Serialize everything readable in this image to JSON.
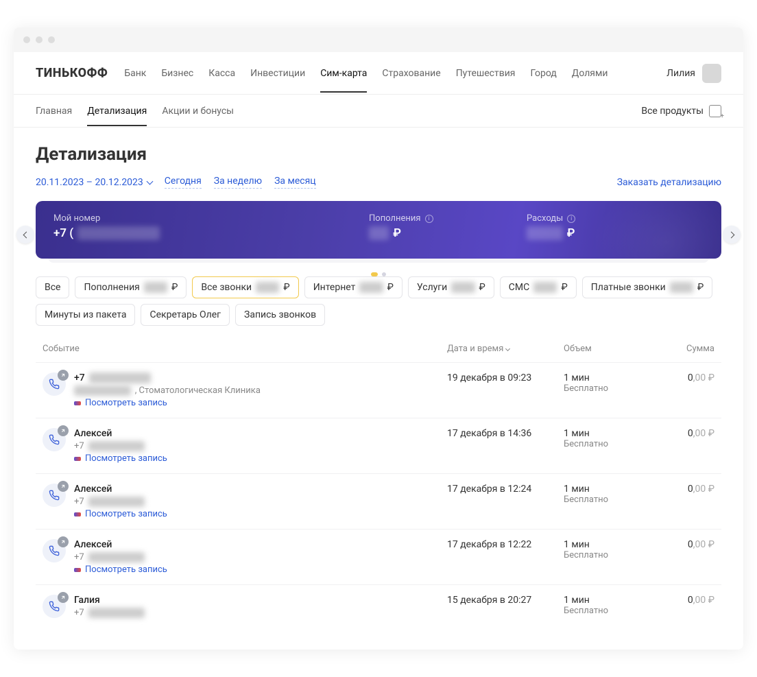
{
  "brand": "ТИНЬКОФФ",
  "user": {
    "name": "Лилия"
  },
  "topnav": [
    "Банк",
    "Бизнес",
    "Касса",
    "Инвестиции",
    "Сим-карта",
    "Страхование",
    "Путешествия",
    "Город",
    "Долями"
  ],
  "topnav_active": 4,
  "subnav": {
    "items": [
      "Главная",
      "Детализация",
      "Акции и бонусы"
    ],
    "active": 1,
    "all_products": "Все продукты"
  },
  "page_title": "Детализация",
  "range": {
    "date_text": "20.11.2023 – 20.12.2023",
    "today": "Сегодня",
    "week": "За неделю",
    "month": "За месяц",
    "order": "Заказать детализацию"
  },
  "hero": {
    "my_number_label": "Мой номер",
    "my_number_prefix": "+7 (",
    "topups_label": "Пополнения",
    "expenses_label": "Расходы",
    "currency": "₽"
  },
  "chips": [
    {
      "label": "Все"
    },
    {
      "label": "Пополнения",
      "suffix": "₽",
      "masked": true
    },
    {
      "label": "Все звонки",
      "suffix": "₽",
      "masked": true,
      "active": true
    },
    {
      "label": "Интернет",
      "suffix": "₽",
      "masked": true
    },
    {
      "label": "Услуги",
      "suffix": "₽",
      "masked": true
    },
    {
      "label": "СМС",
      "suffix": "₽",
      "masked": true
    },
    {
      "label": "Платные звонки",
      "suffix": "₽",
      "masked": true
    },
    {
      "label": "Минуты из пакета"
    },
    {
      "label": "Секретарь Олег"
    },
    {
      "label": "Запись звонков"
    }
  ],
  "table": {
    "headers": {
      "event": "Событие",
      "date": "Дата и время",
      "volume": "Объем",
      "sum": "Сумма"
    },
    "record_link": "Посмотреть запись",
    "rows": [
      {
        "title_prefix": "+7",
        "title_masked": true,
        "sub_text": ", Стоматологическая Клиника",
        "sub_masked": true,
        "has_record": true,
        "date": "19 декабря в 09:23",
        "vol": "1 мин",
        "vol_sub": "Бесплатно",
        "sum_int": "0",
        "sum_dec": ",00 ₽"
      },
      {
        "title_text": "Алексей",
        "sub_prefix": "+7",
        "sub_masked": true,
        "has_record": true,
        "date": "17 декабря в 14:36",
        "vol": "1 мин",
        "vol_sub": "Бесплатно",
        "sum_int": "0",
        "sum_dec": ",00 ₽"
      },
      {
        "title_text": "Алексей",
        "sub_prefix": "+7",
        "sub_masked": true,
        "has_record": true,
        "date": "17 декабря в 12:24",
        "vol": "1 мин",
        "vol_sub": "Бесплатно",
        "sum_int": "0",
        "sum_dec": ",00 ₽"
      },
      {
        "title_text": "Алексей",
        "sub_prefix": "+7",
        "sub_masked": true,
        "has_record": true,
        "date": "17 декабря в 12:22",
        "vol": "1 мин",
        "vol_sub": "Бесплатно",
        "sum_int": "0",
        "sum_dec": ",00 ₽"
      },
      {
        "title_text": "Галия",
        "sub_prefix": "+7",
        "sub_masked": true,
        "has_record": false,
        "date": "15 декабря в 20:27",
        "vol": "1 мин",
        "vol_sub": "Бесплатно",
        "sum_int": "0",
        "sum_dec": ",00 ₽"
      }
    ]
  }
}
